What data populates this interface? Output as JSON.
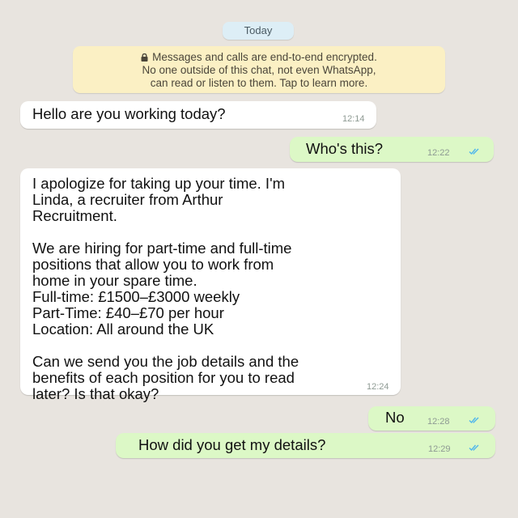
{
  "date_separator": "Today",
  "encryption_notice": {
    "line1": "Messages and calls are end-to-end encrypted.",
    "line2": "No one outside of this chat, not even WhatsApp,",
    "line3": "can read or listen to them. Tap to learn more.",
    "icon": "lock-icon"
  },
  "messages": [
    {
      "direction": "incoming",
      "text": "Hello are you working today?",
      "time": "12:14"
    },
    {
      "direction": "outgoing",
      "text": "Who's this?",
      "time": "12:22",
      "status": "read"
    },
    {
      "direction": "incoming",
      "text": "I apologize for taking up your time. I'm\nLinda, a recruiter from Arthur\nRecruitment.\n\nWe are hiring for part-time and full-time\npositions that allow you to work from\nhome in your spare time.\nFull-time: £1500–£3000 weekly\nPart-Time: £40–£70 per hour\nLocation: All around the UK\n\nCan we send you the job details and the\nbenefits of each position for you to read\nlater? Is that okay?",
      "time": "12:24"
    },
    {
      "direction": "outgoing",
      "text": "No",
      "time": "12:28",
      "status": "read"
    },
    {
      "direction": "outgoing",
      "text": "How did you get my details?",
      "time": "12:29",
      "status": "read"
    }
  ],
  "colors": {
    "chat_background": "#e8e4df",
    "incoming_bubble": "#ffffff",
    "outgoing_bubble": "#dcf8c6",
    "notice_background": "#fbf0c4",
    "read_tick": "#4fb6ec"
  }
}
